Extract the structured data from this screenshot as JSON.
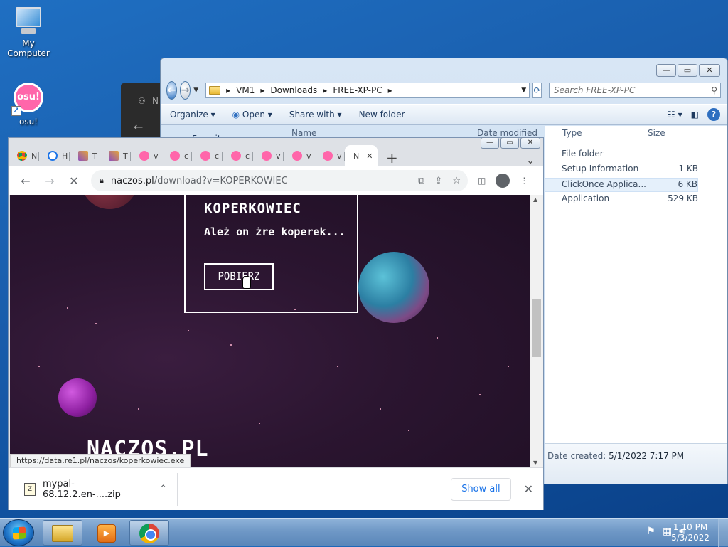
{
  "desktop": {
    "icons": [
      {
        "label": "My Computer"
      },
      {
        "label": "osu!"
      }
    ]
  },
  "explorer": {
    "breadcrumb": [
      "VM1",
      "Downloads",
      "FREE-XP-PC"
    ],
    "search_placeholder": "Search FREE-XP-PC",
    "commands": [
      "Organize",
      "Open",
      "Share with",
      "New folder"
    ],
    "columns": {
      "name": "Name",
      "date": "Date modified",
      "type": "Type",
      "size": "Size"
    },
    "sidebar_partial": "Favorites",
    "files": [
      {
        "type": "File folder",
        "size": ""
      },
      {
        "type": "Setup Information",
        "size": "1 KB"
      },
      {
        "type": "ClickOnce Applica...",
        "size": "6 KB"
      },
      {
        "type": "Application",
        "size": "529 KB"
      }
    ],
    "details": {
      "label": "Date created:",
      "value": "5/1/2022 7:17 PM"
    }
  },
  "chrome": {
    "tabs": [
      {
        "letter": "N",
        "fav": "chrome-fav"
      },
      {
        "letter": "H",
        "fav": "hist"
      },
      {
        "letter": "T",
        "fav": "puzzle"
      },
      {
        "letter": "T",
        "fav": "puzzle"
      },
      {
        "letter": "v",
        "fav": "osu"
      },
      {
        "letter": "c",
        "fav": "osu"
      },
      {
        "letter": "c",
        "fav": "osu"
      },
      {
        "letter": "c",
        "fav": "osu"
      },
      {
        "letter": "v",
        "fav": "osu"
      },
      {
        "letter": "v",
        "fav": "osu"
      },
      {
        "letter": "v",
        "fav": "osu"
      },
      {
        "letter": "N",
        "fav": "",
        "active": true
      }
    ],
    "url": {
      "host": "naczos.pl",
      "path": "/download?v=KOPERKOWIEC"
    },
    "page": {
      "card_title": "KOPERKOWIEC",
      "card_text": "Ależ on żre koperek...",
      "button": "POBIERZ",
      "site_name": "NACZOS.PL"
    },
    "status_url": "https://data.re1.pl/naczos/koperkowiec.exe",
    "download": {
      "filename": "mypal-68.12.2.en-....zip",
      "show_all": "Show all"
    }
  },
  "taskbar": {
    "time": "1:10 PM",
    "date": "5/3/2022"
  }
}
